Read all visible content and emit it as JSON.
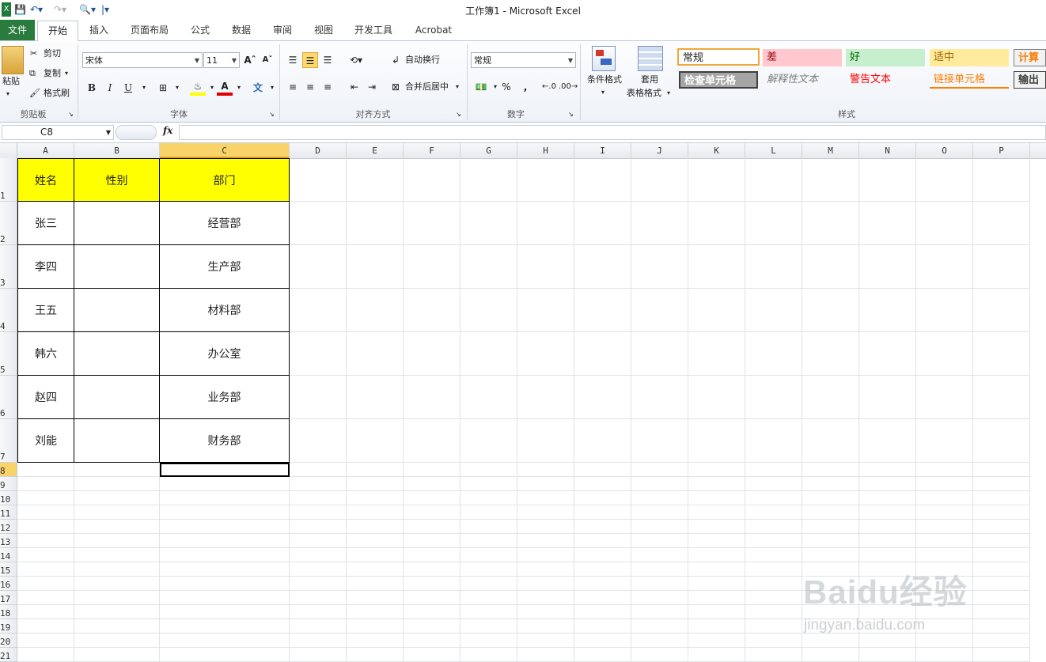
{
  "window": {
    "title": "工作簿1 - Microsoft Excel"
  },
  "tabs": [
    "文件",
    "开始",
    "插入",
    "页面布局",
    "公式",
    "数据",
    "审阅",
    "视图",
    "开发工具",
    "Acrobat"
  ],
  "ribbon": {
    "clipboard": {
      "paste": "粘贴",
      "cut": "剪切",
      "copy": "复制",
      "format_painter": "格式刷",
      "label": "剪贴板"
    },
    "font": {
      "name": "宋体",
      "size": "11",
      "label": "字体",
      "bold": "B",
      "italic": "I",
      "underline": "U"
    },
    "alignment": {
      "wrap": "自动换行",
      "merge": "合并后居中",
      "label": "对齐方式"
    },
    "number": {
      "format": "常规",
      "percent": "%",
      "comma": ",",
      "label": "数字"
    },
    "styles": {
      "conditional": "条件格式",
      "table_1": "套用",
      "table_2": "表格格式",
      "label": "样式",
      "normal": "常规",
      "bad": "差",
      "good": "好",
      "neutral": "适中",
      "calc": "计算",
      "check": "检查单元格",
      "explain": "解释性文本",
      "warning": "警告文本",
      "linked": "链接单元格",
      "output": "输出"
    }
  },
  "formula_bar": {
    "name_box": "C8",
    "fx": "fx",
    "value": ""
  },
  "columns": [
    "A",
    "B",
    "C",
    "D",
    "E",
    "F",
    "G",
    "H",
    "I",
    "J",
    "K",
    "L",
    "M",
    "N",
    "O",
    "P"
  ],
  "rows": [
    "1",
    "2",
    "3",
    "4",
    "5",
    "6",
    "7",
    "8",
    "9",
    "10",
    "11",
    "12",
    "13",
    "14",
    "15",
    "16",
    "17",
    "18",
    "19",
    "20",
    "21"
  ],
  "table": {
    "headers": [
      "姓名",
      "性别",
      "部门"
    ],
    "rows": [
      [
        "张三",
        "",
        "经营部"
      ],
      [
        "李四",
        "",
        "生产部"
      ],
      [
        "王五",
        "",
        "材料部"
      ],
      [
        "韩六",
        "",
        "办公室"
      ],
      [
        "赵四",
        "",
        "业务部"
      ],
      [
        "刘能",
        "",
        "财务部"
      ]
    ]
  },
  "watermark": {
    "brand": "Baidu经验",
    "url": "jingyan.baidu.com"
  },
  "colors": {
    "header_fill": "#ffff00",
    "file_tab": "#2a7b3e",
    "selected_col": "#f8d36a"
  }
}
